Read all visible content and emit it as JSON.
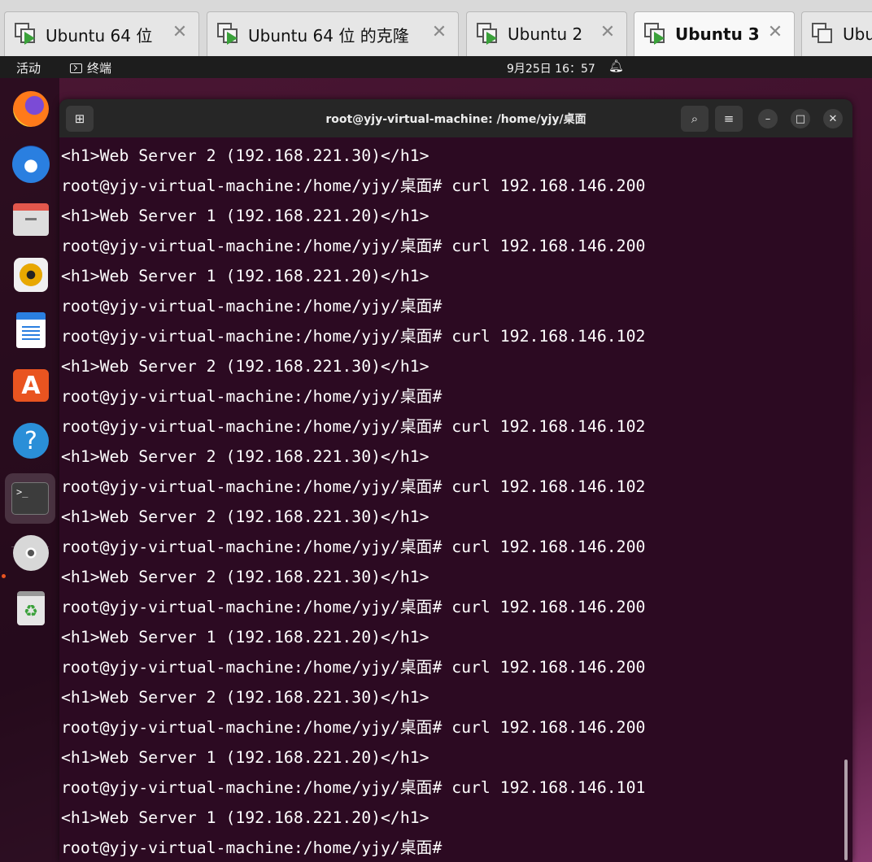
{
  "vm_tabs": [
    {
      "label": "Ubuntu 64 位",
      "close": "✕"
    },
    {
      "label": "Ubuntu 64 位 的克隆",
      "close": "✕"
    },
    {
      "label": "Ubuntu 2",
      "close": "✕"
    },
    {
      "label": "Ubuntu 3",
      "close": "✕"
    },
    {
      "label": "Ubu",
      "close": ""
    }
  ],
  "top_bar": {
    "activities": "活动",
    "app_menu": "终端",
    "clock": "9月25日 16：57",
    "bell_icon": "bell-icon"
  },
  "dock": {
    "items": [
      {
        "name": "firefox-icon"
      },
      {
        "name": "thunderbird-icon"
      },
      {
        "name": "files-icon"
      },
      {
        "name": "rhythmbox-icon"
      },
      {
        "name": "libreoffice-writer-icon"
      },
      {
        "name": "app-center-icon",
        "glyph": "A"
      },
      {
        "name": "help-icon",
        "glyph": "?"
      },
      {
        "name": "terminal-icon",
        "glyph": ">_",
        "running": true
      },
      {
        "name": "dvd-icon"
      },
      {
        "name": "trash-icon",
        "glyph": "♻"
      }
    ]
  },
  "terminal": {
    "title": "root@yjy-virtual-machine: /home/yjy/桌面",
    "header_buttons": {
      "new_tab": "⊞",
      "search": "⌕",
      "menu": "≡",
      "minimize": "–",
      "maximize": "□",
      "close": "✕"
    },
    "lines": [
      "<h1>Web Server 2 (192.168.221.30)</h1>",
      "root@yjy-virtual-machine:/home/yjy/桌面# curl 192.168.146.200",
      "<h1>Web Server 1 (192.168.221.20)</h1>",
      "root@yjy-virtual-machine:/home/yjy/桌面# curl 192.168.146.200",
      "<h1>Web Server 1 (192.168.221.20)</h1>",
      "root@yjy-virtual-machine:/home/yjy/桌面#",
      "root@yjy-virtual-machine:/home/yjy/桌面# curl 192.168.146.102",
      "<h1>Web Server 2 (192.168.221.30)</h1>",
      "root@yjy-virtual-machine:/home/yjy/桌面#",
      "root@yjy-virtual-machine:/home/yjy/桌面# curl 192.168.146.102",
      "<h1>Web Server 2 (192.168.221.30)</h1>",
      "root@yjy-virtual-machine:/home/yjy/桌面# curl 192.168.146.102",
      "<h1>Web Server 2 (192.168.221.30)</h1>",
      "root@yjy-virtual-machine:/home/yjy/桌面# curl 192.168.146.200",
      "<h1>Web Server 2 (192.168.221.30)</h1>",
      "root@yjy-virtual-machine:/home/yjy/桌面# curl 192.168.146.200",
      "<h1>Web Server 1 (192.168.221.20)</h1>",
      "root@yjy-virtual-machine:/home/yjy/桌面# curl 192.168.146.200",
      "<h1>Web Server 2 (192.168.221.30)</h1>",
      "root@yjy-virtual-machine:/home/yjy/桌面# curl 192.168.146.200",
      "<h1>Web Server 1 (192.168.221.20)</h1>",
      "root@yjy-virtual-machine:/home/yjy/桌面# curl 192.168.146.101",
      "<h1>Web Server 1 (192.168.221.20)</h1>",
      "root@yjy-virtual-machine:/home/yjy/桌面#"
    ]
  },
  "colors": {
    "terminal_bg": "#2c0a22",
    "header_bg": "#262626",
    "ubuntu_orange": "#e95420"
  }
}
